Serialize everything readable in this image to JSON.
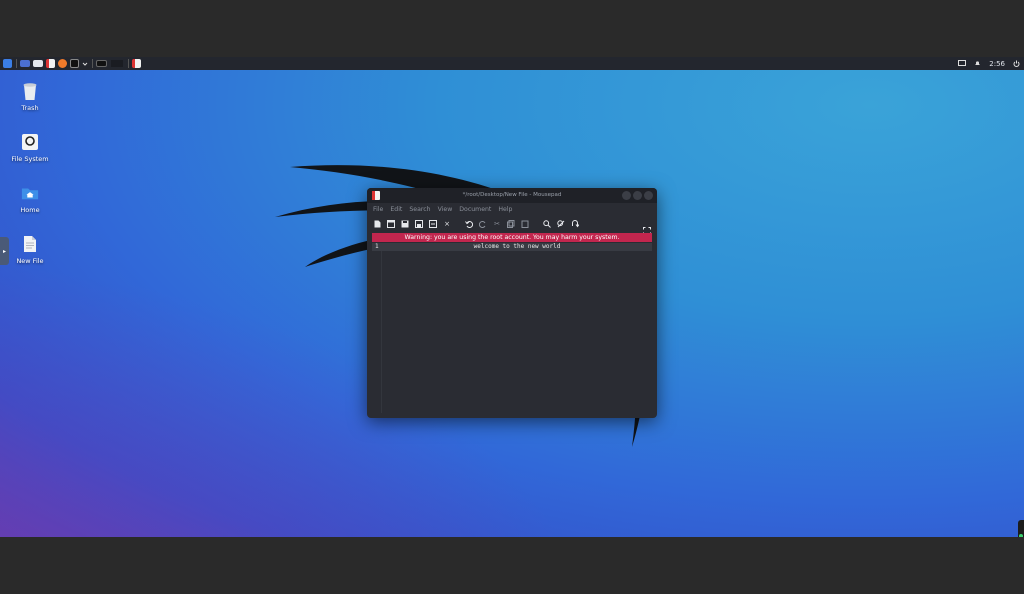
{
  "panel": {
    "launchers": [
      {
        "icon": "kali-menu-icon"
      },
      {
        "icon": "workspace-icon"
      },
      {
        "icon": "files-icon"
      },
      {
        "icon": "text-editor-icon"
      },
      {
        "icon": "firefox-icon"
      },
      {
        "icon": "terminal-icon"
      },
      {
        "icon": "chevron-down-icon"
      }
    ],
    "clock": "2:56"
  },
  "desktop": {
    "icons": [
      {
        "label": "Trash",
        "icon": "trash-icon"
      },
      {
        "label": "File System",
        "icon": "drive-icon"
      },
      {
        "label": "Home",
        "icon": "home-folder-icon"
      },
      {
        "label": "New File",
        "icon": "document-icon"
      }
    ]
  },
  "window": {
    "title": "*/root/Desktop/New File - Mousepad",
    "menu": [
      "File",
      "Edit",
      "Search",
      "View",
      "Document",
      "Help"
    ],
    "warning": "Warning: you are using the root account. You may harm your system.",
    "line_number": "1",
    "line_text": "welcome to the new world"
  },
  "colors": {
    "warning_bg": "#c2264e",
    "panel_bg": "#23262e",
    "window_bg": "#2a2c33"
  }
}
